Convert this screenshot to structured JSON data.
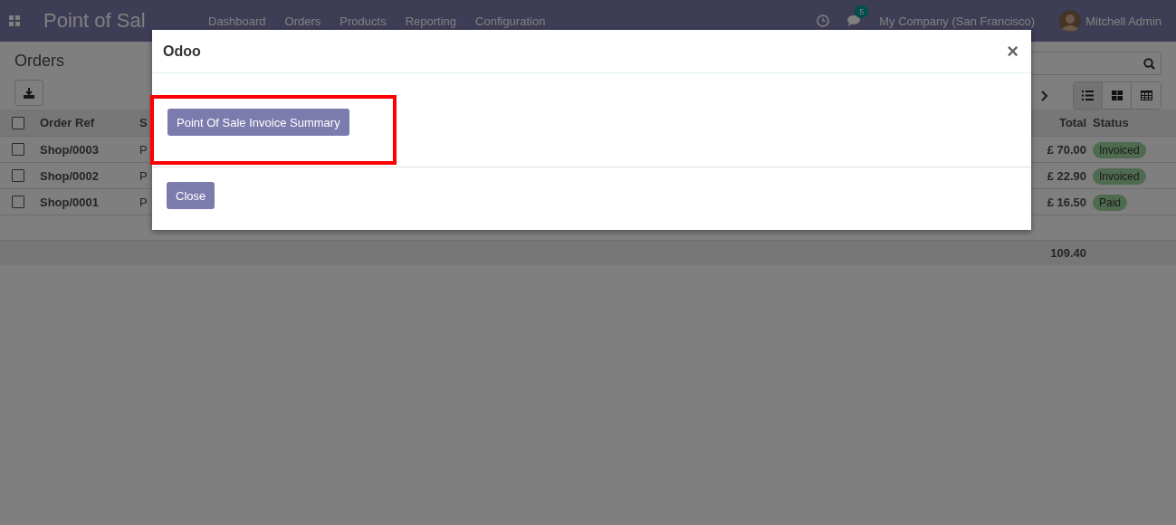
{
  "navbar": {
    "app_title": "Point of Sal",
    "menu": [
      "Dashboard",
      "Orders",
      "Products",
      "Reporting",
      "Configuration"
    ],
    "message_count": "5",
    "company": "My Company (San Francisco)",
    "user": "Mitchell Admin"
  },
  "page": {
    "title": "Orders"
  },
  "view_switcher": [
    {
      "kind": "list",
      "selected": true
    },
    {
      "kind": "kanban",
      "selected": false
    },
    {
      "kind": "grid",
      "selected": false
    }
  ],
  "table": {
    "select_all_checked": false,
    "columns": [
      "Order Ref",
      "S",
      "Total",
      "Status"
    ],
    "rows": [
      {
        "checked": false,
        "ref": "Shop/0003",
        "column_2": "P",
        "total": "£ 70.00",
        "status": "Invoiced"
      },
      {
        "checked": false,
        "ref": "Shop/0002",
        "column_2": "P",
        "total": "£ 22.90",
        "status": "Invoiced"
      },
      {
        "checked": false,
        "ref": "Shop/0001",
        "column_2": "P",
        "total": "£ 16.50",
        "status": "Paid"
      }
    ],
    "sum": "109.40"
  },
  "dialog": {
    "title": "Odoo",
    "action": "Point Of Sale Invoice Summary",
    "close_button": "Close",
    "close_glyph": "×"
  }
}
